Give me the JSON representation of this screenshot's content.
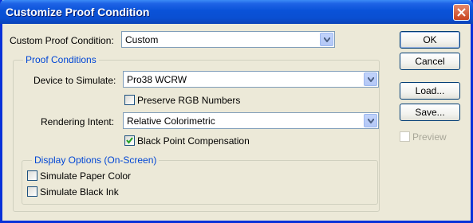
{
  "window": {
    "title": "Customize Proof Condition"
  },
  "custom_proof": {
    "label": "Custom Proof Condition:",
    "value": "Custom"
  },
  "proof_conditions": {
    "legend": "Proof Conditions",
    "device_label": "Device to Simulate:",
    "device_value": "Pro38 WCRW",
    "preserve_rgb": {
      "label": "Preserve RGB Numbers",
      "checked": false
    },
    "intent_label": "Rendering Intent:",
    "intent_value": "Relative Colorimetric",
    "black_point": {
      "label": "Black Point Compensation",
      "checked": true
    }
  },
  "display_options": {
    "legend": "Display Options (On-Screen)",
    "paper_color": {
      "label": "Simulate Paper Color",
      "checked": false
    },
    "black_ink": {
      "label": "Simulate Black Ink",
      "checked": false
    }
  },
  "buttons": {
    "ok": "OK",
    "cancel": "Cancel",
    "load": "Load...",
    "save": "Save...",
    "preview": {
      "label": "Preview",
      "checked": false,
      "enabled": false
    }
  },
  "colors": {
    "title_bar": "#0a52d8",
    "group_legend": "#0046d5",
    "face": "#ece9d8"
  }
}
